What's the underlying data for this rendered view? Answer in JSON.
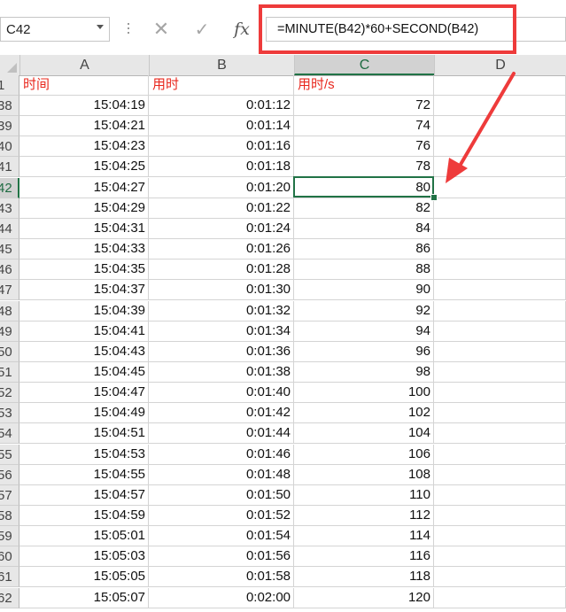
{
  "formula_bar": {
    "name_box": "C42",
    "cancel_icon": "✕",
    "enter_icon": "✓",
    "fx_label": "fx",
    "formula": "=MINUTE(B42)*60+SECOND(B42)"
  },
  "columns": [
    "A",
    "B",
    "C",
    "D"
  ],
  "selected_column": "C",
  "header_row": {
    "row": "1",
    "a": "时间",
    "b": "用时",
    "c": "用时/s"
  },
  "rows": [
    {
      "row": "38",
      "a": "15:04:19",
      "b": "0:01:12",
      "c": "72"
    },
    {
      "row": "39",
      "a": "15:04:21",
      "b": "0:01:14",
      "c": "74"
    },
    {
      "row": "40",
      "a": "15:04:23",
      "b": "0:01:16",
      "c": "76"
    },
    {
      "row": "41",
      "a": "15:04:25",
      "b": "0:01:18",
      "c": "78"
    },
    {
      "row": "42",
      "a": "15:04:27",
      "b": "0:01:20",
      "c": "80"
    },
    {
      "row": "43",
      "a": "15:04:29",
      "b": "0:01:22",
      "c": "82"
    },
    {
      "row": "44",
      "a": "15:04:31",
      "b": "0:01:24",
      "c": "84"
    },
    {
      "row": "45",
      "a": "15:04:33",
      "b": "0:01:26",
      "c": "86"
    },
    {
      "row": "46",
      "a": "15:04:35",
      "b": "0:01:28",
      "c": "88"
    },
    {
      "row": "47",
      "a": "15:04:37",
      "b": "0:01:30",
      "c": "90"
    },
    {
      "row": "48",
      "a": "15:04:39",
      "b": "0:01:32",
      "c": "92"
    },
    {
      "row": "49",
      "a": "15:04:41",
      "b": "0:01:34",
      "c": "94"
    },
    {
      "row": "50",
      "a": "15:04:43",
      "b": "0:01:36",
      "c": "96"
    },
    {
      "row": "51",
      "a": "15:04:45",
      "b": "0:01:38",
      "c": "98"
    },
    {
      "row": "52",
      "a": "15:04:47",
      "b": "0:01:40",
      "c": "100"
    },
    {
      "row": "53",
      "a": "15:04:49",
      "b": "0:01:42",
      "c": "102"
    },
    {
      "row": "54",
      "a": "15:04:51",
      "b": "0:01:44",
      "c": "104"
    },
    {
      "row": "55",
      "a": "15:04:53",
      "b": "0:01:46",
      "c": "106"
    },
    {
      "row": "56",
      "a": "15:04:55",
      "b": "0:01:48",
      "c": "108"
    },
    {
      "row": "57",
      "a": "15:04:57",
      "b": "0:01:50",
      "c": "110"
    },
    {
      "row": "58",
      "a": "15:04:59",
      "b": "0:01:52",
      "c": "112"
    },
    {
      "row": "59",
      "a": "15:05:01",
      "b": "0:01:54",
      "c": "114"
    },
    {
      "row": "60",
      "a": "15:05:03",
      "b": "0:01:56",
      "c": "116"
    },
    {
      "row": "61",
      "a": "15:05:05",
      "b": "0:01:58",
      "c": "118"
    },
    {
      "row": "62",
      "a": "15:05:07",
      "b": "0:02:00",
      "c": "120"
    }
  ],
  "selected_row": "42",
  "colors": {
    "accent_green": "#217346",
    "annotation_red": "#ee3b3b",
    "header_text_red": "#e8281e"
  }
}
